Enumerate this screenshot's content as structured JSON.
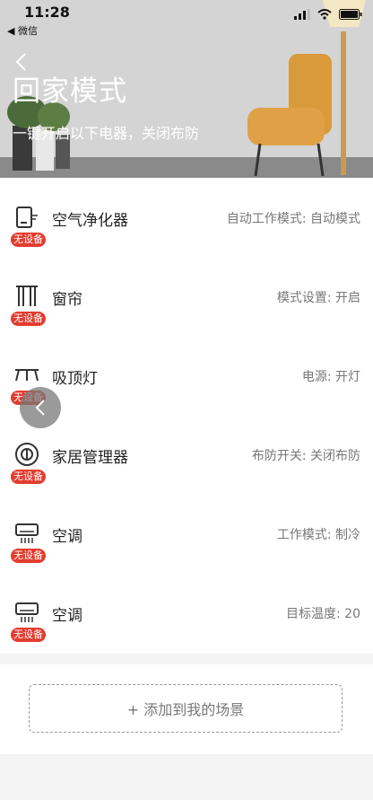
{
  "status": {
    "time": "11:28",
    "back_app": "◀ 微信"
  },
  "header": {
    "title": "回家模式",
    "subtitle": "一键开启以下电器，关闭布防"
  },
  "devices": [
    {
      "name": "空气净化器",
      "value": "自动工作模式: 自动模式",
      "badge": "无设备",
      "icon": "air-purifier-icon"
    },
    {
      "name": "窗帘",
      "value": "模式设置: 开启",
      "badge": "无设备",
      "icon": "curtain-icon"
    },
    {
      "name": "吸顶灯",
      "value": "电源: 开灯",
      "badge": "无设备",
      "icon": "ceiling-light-icon"
    },
    {
      "name": "家居管理器",
      "value": "布防开关: 关闭布防",
      "badge": "无设备",
      "icon": "home-manager-icon"
    },
    {
      "name": "空调",
      "value": "工作模式: 制冷",
      "badge": "无设备",
      "icon": "air-conditioner-icon"
    },
    {
      "name": "空调",
      "value": "目标温度: 20",
      "badge": "无设备",
      "icon": "air-conditioner-icon"
    }
  ],
  "footer": {
    "add_label": "+ 添加到我的场景"
  },
  "colors": {
    "badge": "#e33c2e",
    "title": "#ffffff"
  }
}
